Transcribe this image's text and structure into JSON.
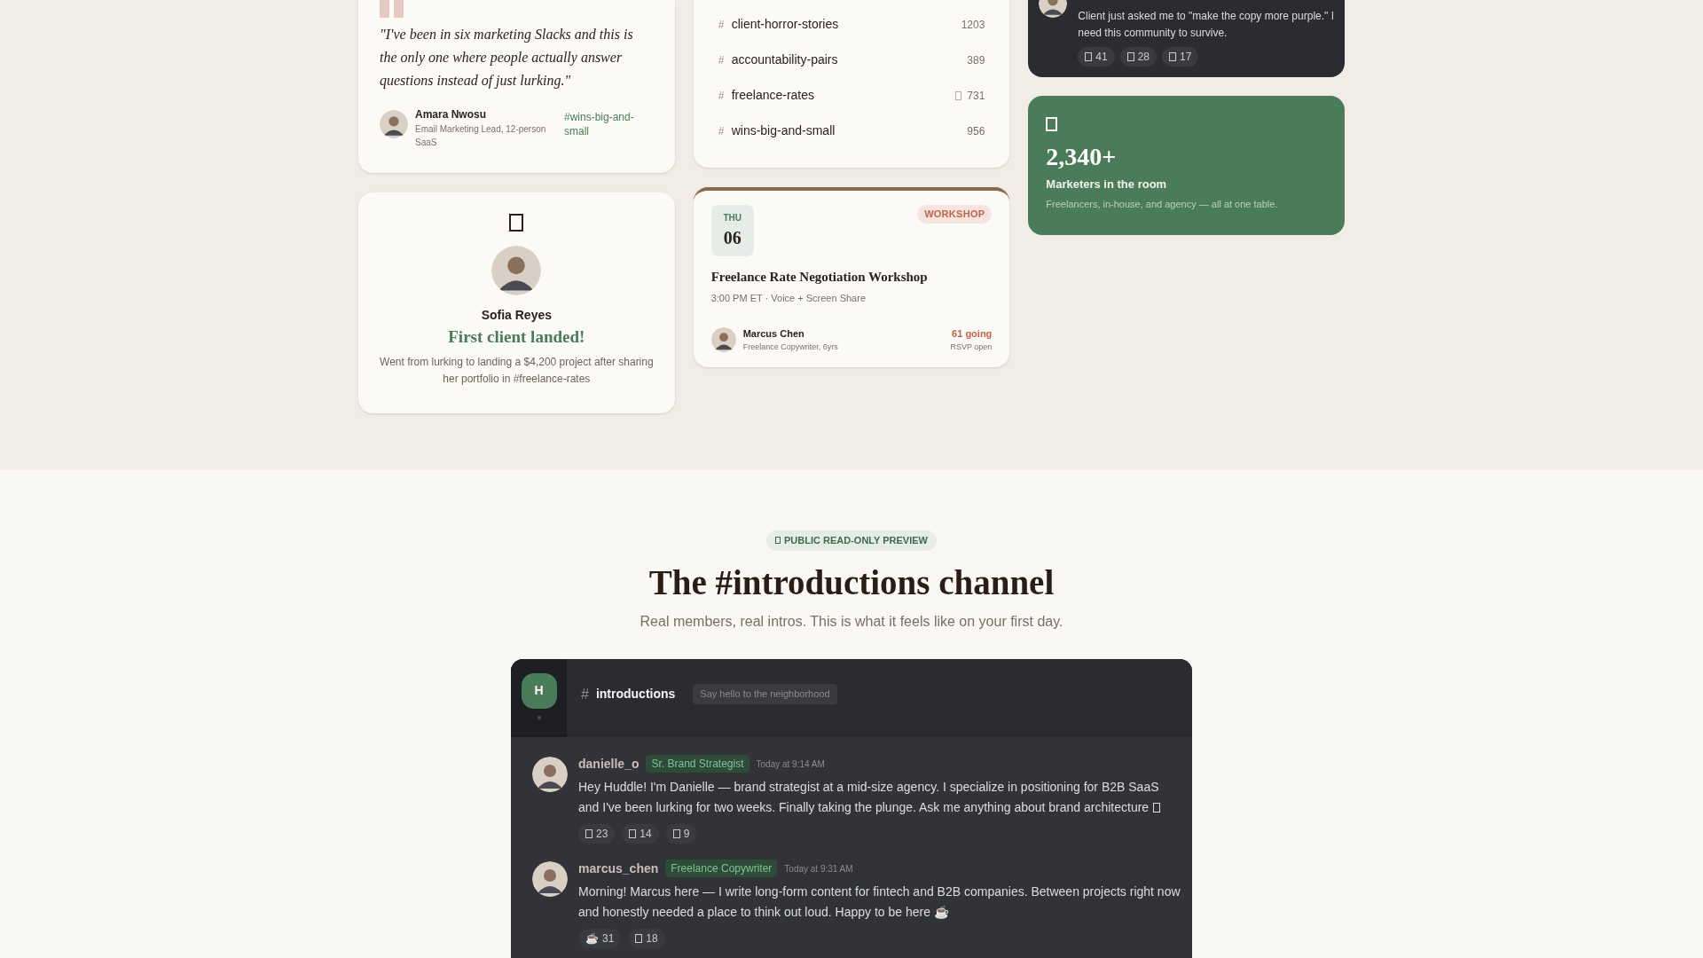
{
  "testimonial": {
    "quote": "\"I've been in six marketing Slacks and this is the only one where people actually answer questions instead of just lurking.\"",
    "author": "Amara Nwosu",
    "role": "Email Marketing Lead, 12-person SaaS",
    "channel": "#wins-big-and-small"
  },
  "win_card": {
    "name": "Sofia Reyes",
    "headline": "First client landed!",
    "description": "Went from lurking to landing a $4,200 project after sharing her portfolio in #freelance-rates"
  },
  "channels": [
    {
      "marker": "#",
      "name": "client-horror-stories",
      "count": "1203",
      "hot": false
    },
    {
      "marker": "#",
      "name": "accountability-pairs",
      "count": "389",
      "hot": false
    },
    {
      "marker": "#",
      "name": "freelance-rates",
      "count": "731",
      "hot": true
    },
    {
      "marker": "#",
      "name": "wins-big-and-small",
      "count": "956",
      "hot": false
    }
  ],
  "event": {
    "day": "THU",
    "date": "06",
    "tag": "WORKSHOP",
    "title": "Freelance Rate Negotiation Workshop",
    "details": "3:00 PM ET · Voice + Screen Share",
    "host": "Marcus Chen",
    "host_role": "Freelance Copywriter, 6yrs",
    "going": "61 going",
    "rsvp": "RSVP open"
  },
  "post_card": {
    "text": "Client just asked me to \"make the copy more purple.\" I need this community to survive.",
    "reactions": [
      {
        "count": "41"
      },
      {
        "count": "28"
      },
      {
        "count": "17"
      }
    ]
  },
  "stat": {
    "value": "2,340+",
    "label": "Marketers in the room",
    "description": "Freelancers, in-house, and agency — all at one table."
  },
  "preview": {
    "badge": "PUBLIC READ-ONLY PREVIEW",
    "title": "The #introductions channel",
    "subtitle": "Real members, real intros. This is what it feels like on your first day."
  },
  "chat": {
    "server_initial": "H",
    "marker": "#",
    "channel": "introductions",
    "topic": "Say hello to the neighborhood",
    "messages": [
      {
        "user": "danielle_o",
        "role": "Sr. Brand Strategist",
        "time": "Today at 9:14 AM",
        "text": "Hey Huddle! I'm Danielle — brand strategist at a mid-size agency. I specialize in positioning for B2B SaaS and I've been lurking for two weeks. Finally taking the plunge. Ask me anything about brand architecture",
        "trailing_icon": true,
        "reactions": [
          {
            "count": "23"
          },
          {
            "count": "14"
          },
          {
            "count": "9"
          }
        ]
      },
      {
        "user": "marcus_chen",
        "role": "Freelance Copywriter",
        "time": "Today at 9:31 AM",
        "text": "Morning! Marcus here — I write long-form content for fintech and B2B companies. Between projects right now and honestly needed a place to think out loud. Happy to be here ☕",
        "trailing_icon": false,
        "reactions": [
          {
            "emoji": "☕",
            "count": "31"
          },
          {
            "count": "18"
          }
        ]
      }
    ]
  }
}
